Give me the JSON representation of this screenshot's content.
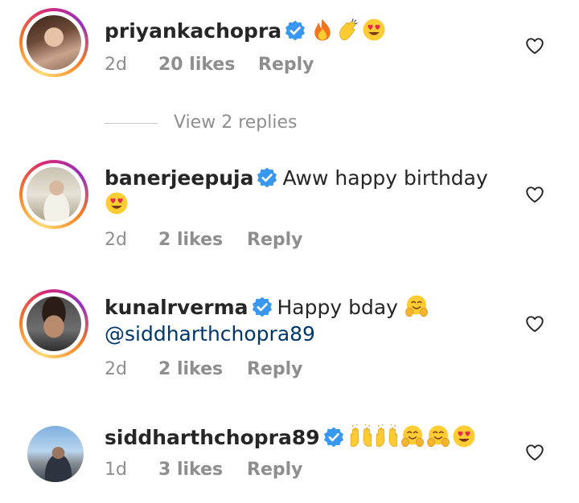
{
  "comments": [
    {
      "username": "priyankachopra",
      "text": "",
      "emojis": [
        "fire-emoji",
        "clapping-hands-emoji",
        "heart-eyes-emoji"
      ],
      "time": "2d",
      "likes": "20 likes",
      "reply": "Reply"
    },
    {
      "username": "banerjeepuja",
      "text": "Aww happy birthday",
      "emojis": [
        "heart-eyes-emoji"
      ],
      "time": "2d",
      "likes": "2 likes",
      "reply": "Reply"
    },
    {
      "username": "kunalrverma",
      "text": "Happy bday",
      "mention": "@siddharthchopra89",
      "emojis": [
        "hugging-face-emoji"
      ],
      "time": "2d",
      "likes": "2 likes",
      "reply": "Reply"
    },
    {
      "username": "siddharthchopra89",
      "text": "",
      "emojis": [
        "raising-hands-emoji",
        "raising-hands-emoji",
        "hugging-face-emoji",
        "hugging-face-emoji",
        "heart-eyes-emoji"
      ],
      "time": "1d",
      "likes": "3 likes",
      "reply": "Reply"
    }
  ],
  "view_replies": "View 2 replies",
  "colors": {
    "verified": "#3897f0",
    "meta_text": "#8e8e8e",
    "mention": "#00376b",
    "story_ring": [
      "#feda75",
      "#fa7e1e",
      "#d62976",
      "#962fbf"
    ]
  }
}
